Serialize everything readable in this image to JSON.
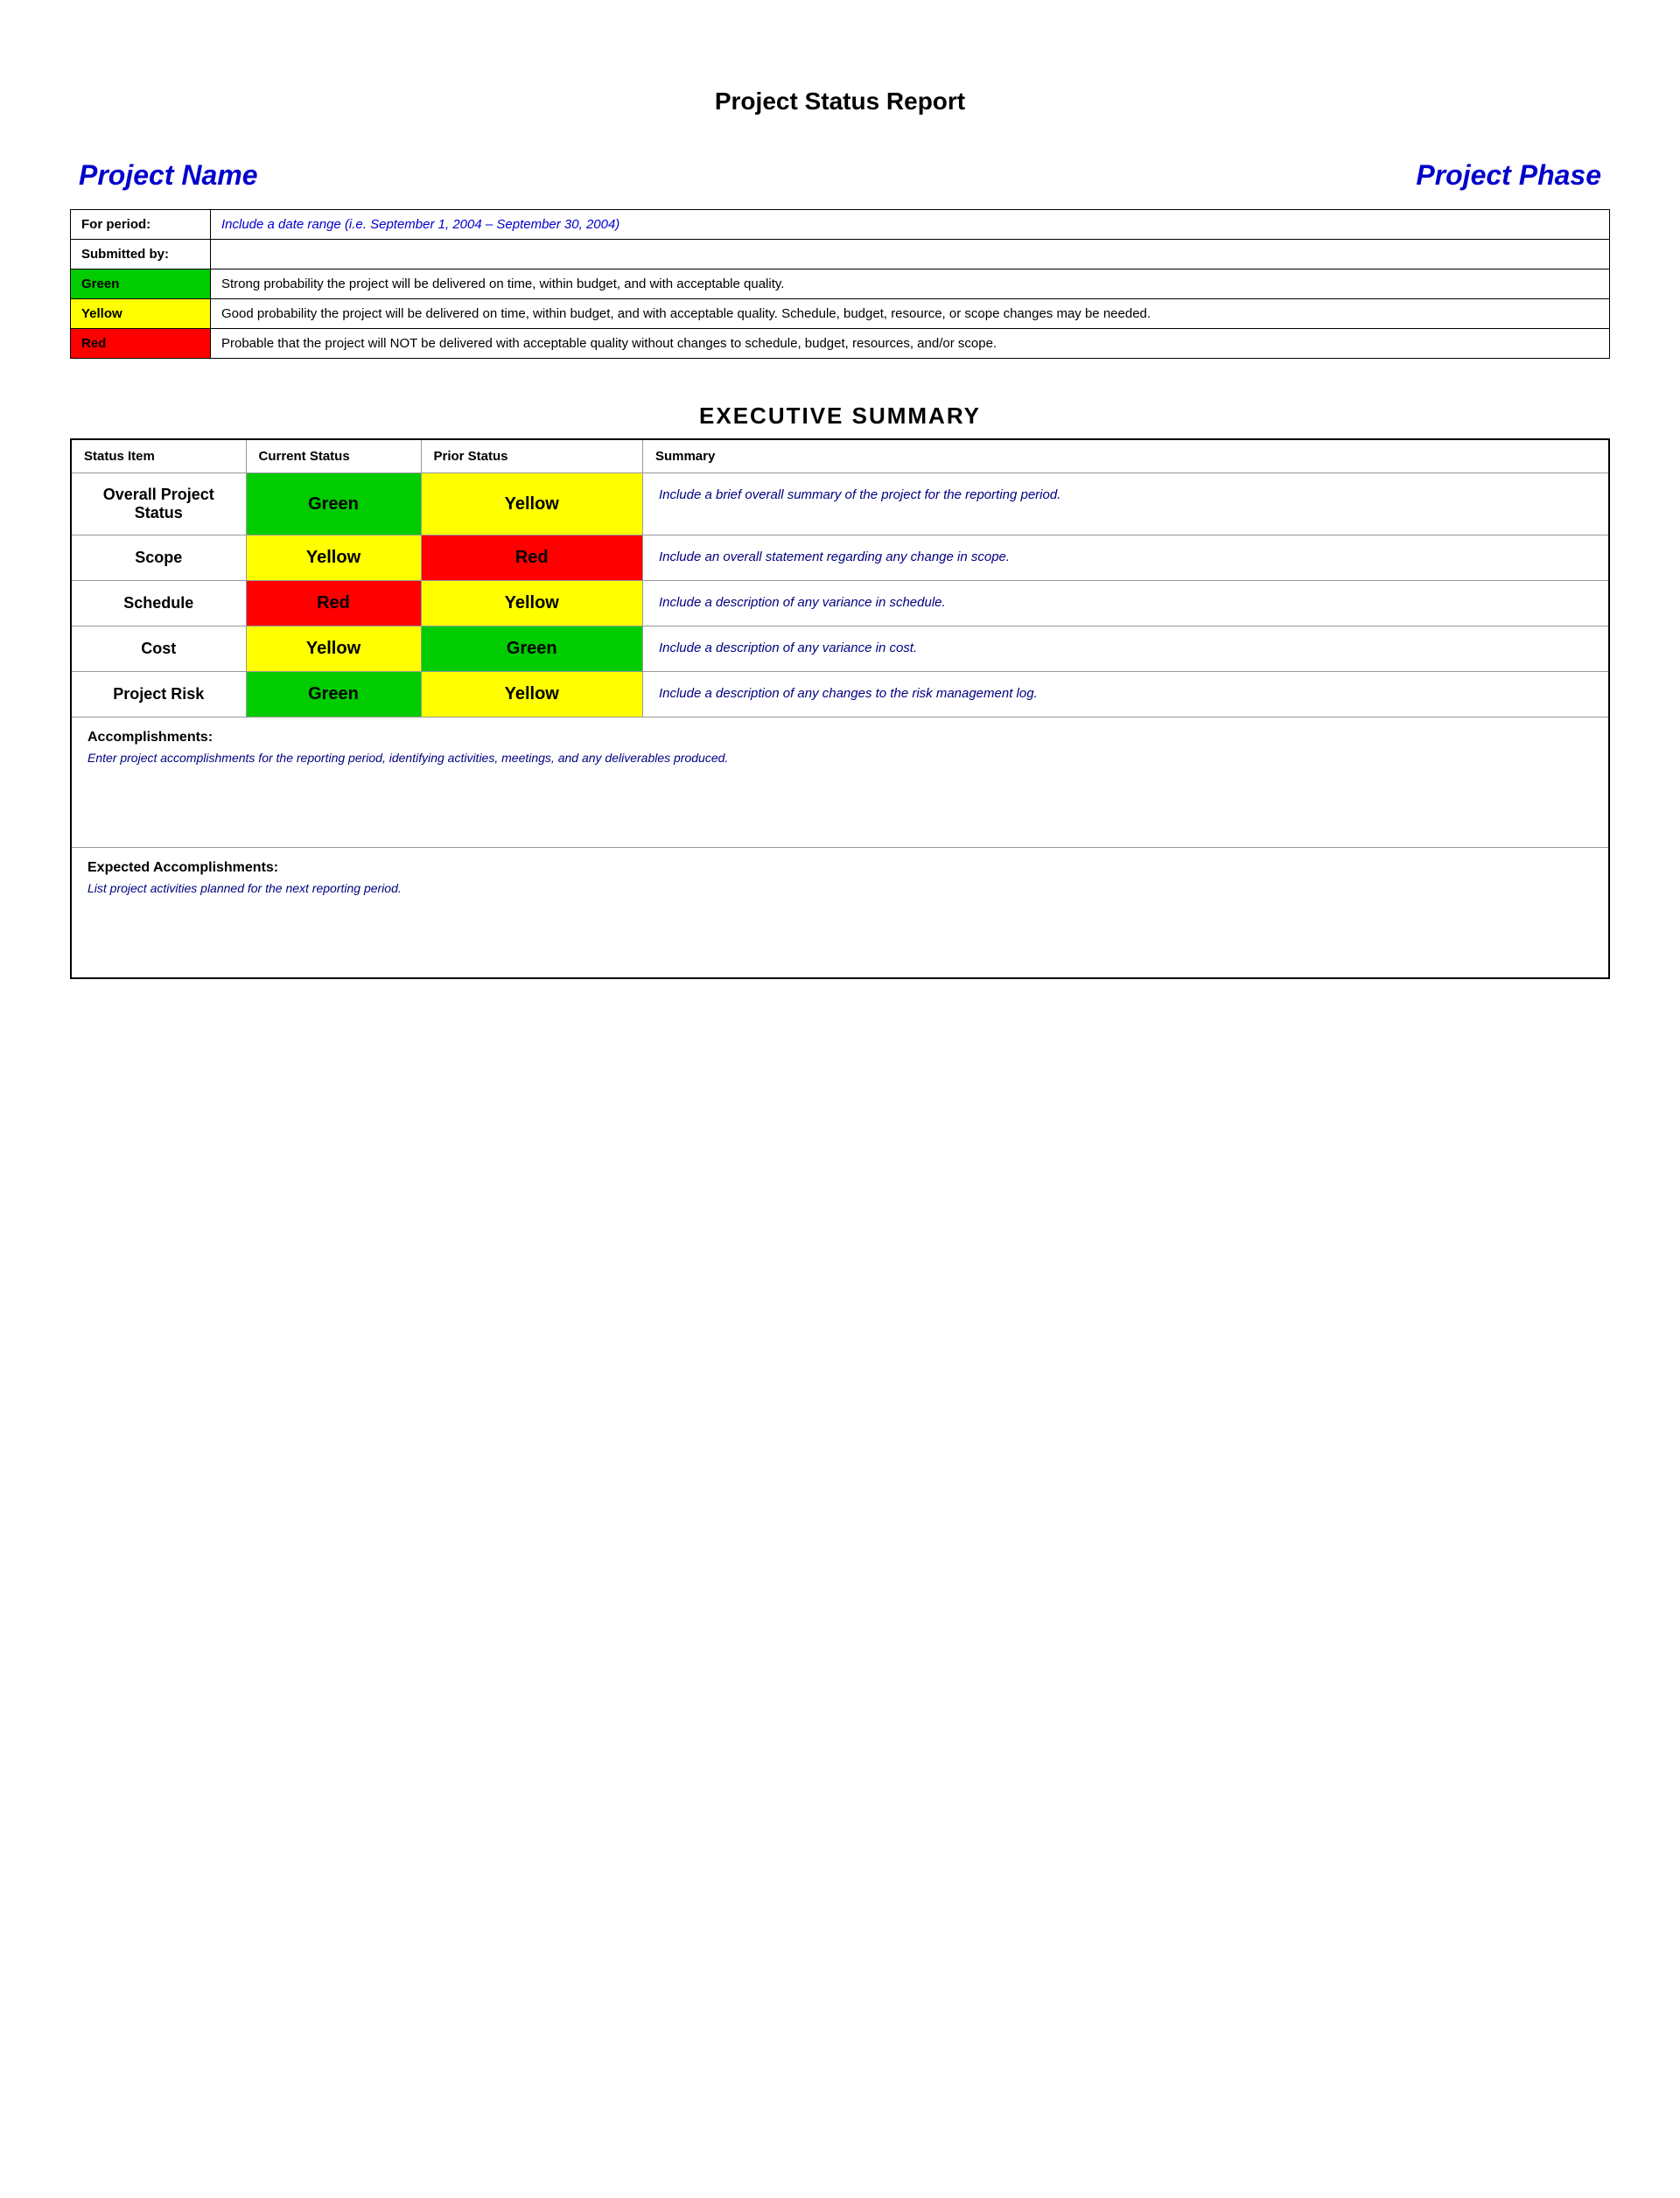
{
  "page": {
    "title": "Project Status Report"
  },
  "header": {
    "project_name_label": "Project Name",
    "project_phase_label": "Project Phase"
  },
  "info_table": {
    "for_period_label": "For period:",
    "for_period_value": "Include a date range (i.e. September 1, 2004 – September 30, 2004)",
    "submitted_by_label": "Submitted by:",
    "submitted_by_value": "",
    "green_label": "Green",
    "green_description": "Strong probability the project will be delivered on time, within budget, and with acceptable quality.",
    "yellow_label": "Yellow",
    "yellow_description": "Good probability the project will be delivered on time, within budget, and with acceptable quality. Schedule, budget, resource, or scope changes may be needed.",
    "red_label": "Red",
    "red_description": "Probable that the project will NOT be delivered with acceptable quality without changes to schedule, budget, resources, and/or scope."
  },
  "executive_summary": {
    "title": "EXECUTIVE SUMMARY",
    "columns": {
      "status_item": "Status Item",
      "current_status": "Current Status",
      "prior_status": "Prior Status",
      "summary": "Summary"
    },
    "rows": [
      {
        "item": "Overall Project Status",
        "current_status": "Green",
        "current_color": "green",
        "prior_status": "Yellow",
        "prior_color": "yellow",
        "summary": "Include a brief overall summary of the project for the reporting period."
      },
      {
        "item": "Scope",
        "current_status": "Yellow",
        "current_color": "yellow",
        "prior_status": "Red",
        "prior_color": "red",
        "summary": "Include an overall statement regarding any change in scope."
      },
      {
        "item": "Schedule",
        "current_status": "Red",
        "current_color": "red",
        "prior_status": "Yellow",
        "prior_color": "yellow",
        "summary": "Include a description of any variance in schedule."
      },
      {
        "item": "Cost",
        "current_status": "Yellow",
        "current_color": "yellow",
        "prior_status": "Green",
        "prior_color": "green",
        "summary": "Include a description of any variance in cost."
      },
      {
        "item": "Project Risk",
        "current_status": "Green",
        "current_color": "green",
        "prior_status": "Yellow",
        "prior_color": "yellow",
        "summary": "Include a description of any changes to the risk management log."
      }
    ],
    "accomplishments": {
      "title": "Accomplishments:",
      "text": "Enter project accomplishments for the reporting period, identifying activities, meetings, and any deliverables produced."
    },
    "expected_accomplishments": {
      "title": "Expected Accomplishments:",
      "text": "List project activities planned for the next reporting period."
    }
  }
}
